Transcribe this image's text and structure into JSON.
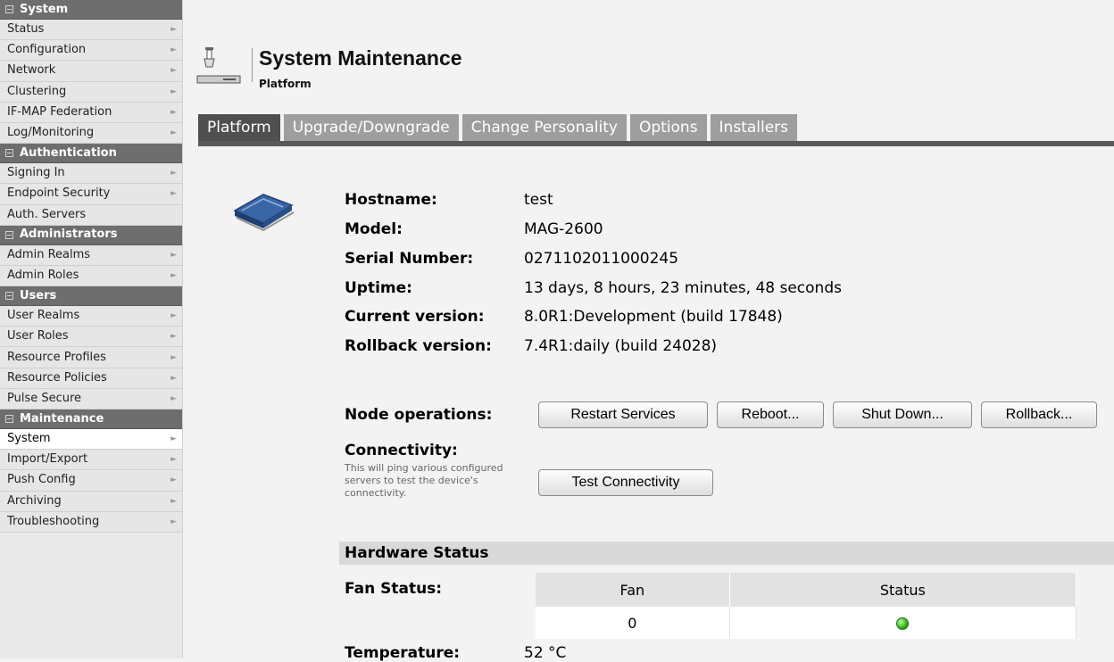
{
  "sidebar": {
    "sections": [
      {
        "title": "System",
        "items": [
          "Status",
          "Configuration",
          "Network",
          "Clustering",
          "IF-MAP Federation",
          "Log/Monitoring"
        ]
      },
      {
        "title": "Authentication",
        "items": [
          "Signing In",
          "Endpoint Security",
          "Auth. Servers"
        ]
      },
      {
        "title": "Administrators",
        "items": [
          "Admin Realms",
          "Admin Roles"
        ]
      },
      {
        "title": "Users",
        "items": [
          "User Realms",
          "User Roles",
          "Resource Profiles",
          "Resource Policies",
          "Pulse Secure"
        ]
      },
      {
        "title": "Maintenance",
        "items": [
          "System",
          "Import/Export",
          "Push Config",
          "Archiving",
          "Troubleshooting"
        ]
      }
    ],
    "active_item": "System"
  },
  "header": {
    "title": "System Maintenance",
    "subtitle": "Platform"
  },
  "tabs": [
    "Platform",
    "Upgrade/Downgrade",
    "Change Personality",
    "Options",
    "Installers"
  ],
  "active_tab": "Platform",
  "platform": {
    "hostname_label": "Hostname:",
    "hostname": "test",
    "model_label": "Model:",
    "model": "MAG-2600",
    "serial_label": "Serial Number:",
    "serial": "0271102011000245",
    "uptime_label": "Uptime:",
    "uptime": "13 days, 8 hours, 23 minutes, 48 seconds",
    "current_version_label": "Current version:",
    "current_version": "8.0R1:Development (build 17848)",
    "rollback_version_label": "Rollback version:",
    "rollback_version": "7.4R1:daily (build 24028)"
  },
  "node_ops": {
    "label": "Node operations:",
    "restart": "Restart Services",
    "reboot": "Reboot...",
    "shutdown": "Shut Down...",
    "rollback": "Rollback..."
  },
  "connectivity": {
    "label": "Connectivity:",
    "description": "This will ping various configured servers to test the device's connectivity.",
    "button": "Test Connectivity"
  },
  "hardware": {
    "title": "Hardware Status",
    "fan_label": "Fan Status:",
    "fan_columns": [
      "Fan",
      "Status"
    ],
    "fan_rows": [
      {
        "fan": "0",
        "status": "ok"
      }
    ],
    "status_color": "#2eae16",
    "temperature_label": "Temperature:",
    "temperature": "52 °C"
  }
}
